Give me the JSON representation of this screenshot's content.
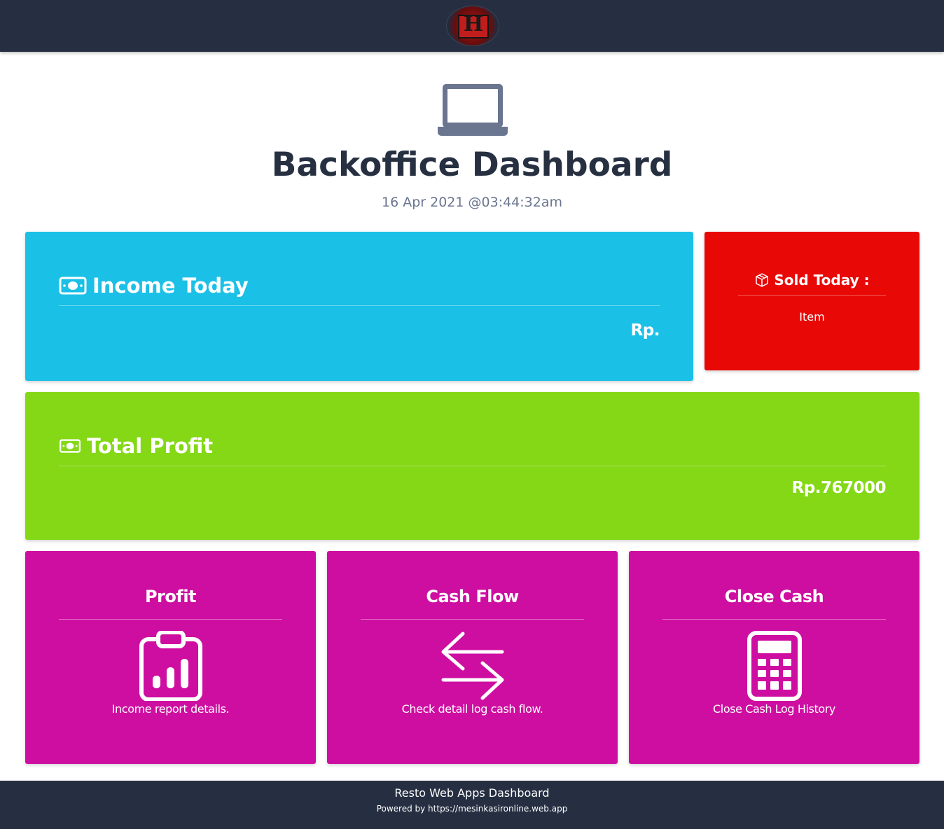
{
  "header": {
    "logo_letter": "H"
  },
  "page": {
    "title": "Backoffice Dashboard",
    "datetime": "16 Apr 2021 @03:44:32am"
  },
  "income": {
    "label": "Income Today",
    "value": "Rp."
  },
  "sold": {
    "label": "Sold Today :",
    "unit": "Item"
  },
  "total_profit": {
    "label": "Total Profit",
    "value": "Rp.767000"
  },
  "tiles": [
    {
      "title": "Profit",
      "description": "Income report details.",
      "icon": "clipboard-chart-icon"
    },
    {
      "title": "Cash Flow",
      "description": "Check detail log cash flow.",
      "icon": "arrows-exchange-icon"
    },
    {
      "title": "Close Cash",
      "description": "Close Cash Log History",
      "icon": "calculator-icon"
    }
  ],
  "footer": {
    "title": "Resto Web Apps Dashboard",
    "powered": "Powered by https://mesinkasironline.web.app"
  },
  "colors": {
    "navbar": "#262f42",
    "income": "#1bc0e7",
    "sold": "#e80806",
    "total_profit": "#84d816",
    "tiles": "#ce0ea1"
  }
}
